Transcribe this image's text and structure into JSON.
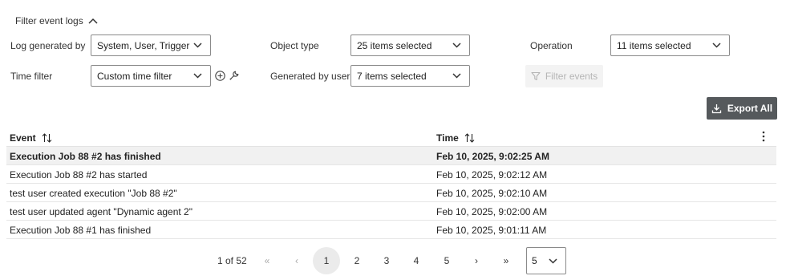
{
  "filter_header": {
    "label": "Filter event logs"
  },
  "filters": {
    "log_generated_by": {
      "label": "Log generated by",
      "value": "System, User, Trigger"
    },
    "object_type": {
      "label": "Object type",
      "value": "25 items selected"
    },
    "operation": {
      "label": "Operation",
      "value": "11 items selected"
    },
    "time_filter": {
      "label": "Time filter",
      "value": "Custom time filter"
    },
    "generated_by_user": {
      "label": "Generated by user",
      "value": "7 items selected"
    },
    "filter_button": "Filter events"
  },
  "export_button": "Export All",
  "table": {
    "columns": [
      "Event",
      "Time"
    ],
    "rows": [
      {
        "event": "Execution Job 88 #2 has finished",
        "time": "Feb 10, 2025, 9:02:25 AM"
      },
      {
        "event": "Execution Job 88 #2 has started",
        "time": "Feb 10, 2025, 9:02:12 AM"
      },
      {
        "event": "test user created execution \"Job 88 #2\"",
        "time": "Feb 10, 2025, 9:02:10 AM"
      },
      {
        "event": "test user updated agent \"Dynamic agent 2\"",
        "time": "Feb 10, 2025, 9:02:00 AM"
      },
      {
        "event": "Execution Job 88 #1 has finished",
        "time": "Feb 10, 2025, 9:01:11 AM"
      }
    ]
  },
  "pagination": {
    "info": "1 of 52",
    "first": "«",
    "prev": "‹",
    "pages": [
      "1",
      "2",
      "3",
      "4",
      "5"
    ],
    "current_page": "1",
    "next": "›",
    "last": "»",
    "page_size": "5"
  },
  "colors": {
    "export_bg": "#55595c",
    "selected_row_bg": "#f1f1f1",
    "disabled_text": "#b5b5b5"
  }
}
